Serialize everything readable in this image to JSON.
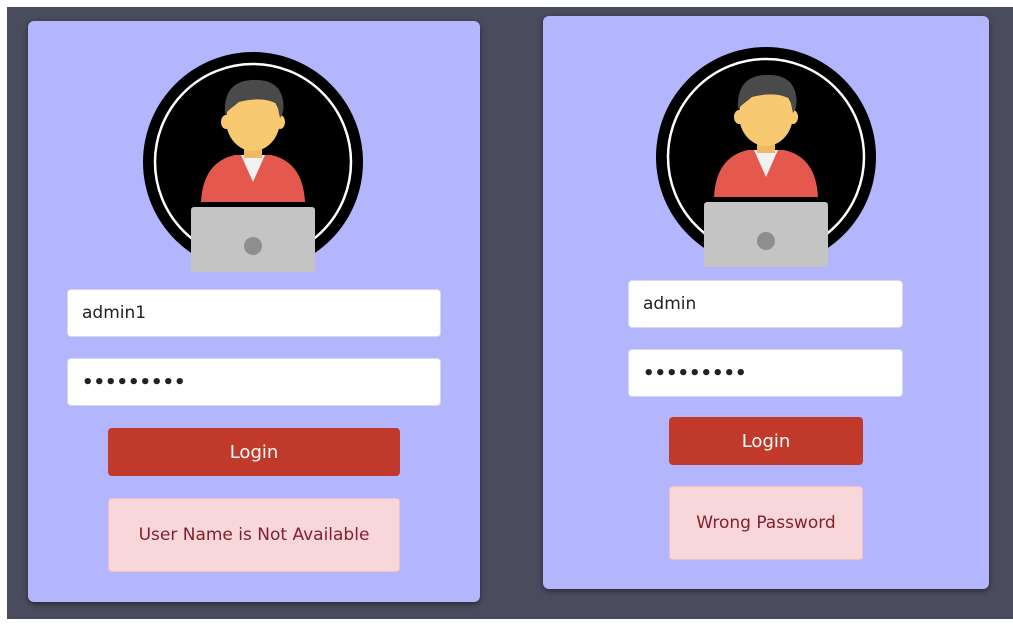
{
  "left_form": {
    "username_value": "admin1",
    "password_value": "•••••••••",
    "login_label": "Login",
    "error_message": "User Name is Not Available"
  },
  "right_form": {
    "username_value": "admin",
    "password_value": "•••••••••",
    "login_label": "Login",
    "error_message": "Wrong Password"
  },
  "icons": {
    "avatar": "user-at-laptop-avatar-icon"
  },
  "colors": {
    "backdrop": "#4a4b5d",
    "card": "#b3b6fd",
    "login_button": "#c0392b",
    "alert_background": "#f8d7da",
    "alert_text": "#842029"
  }
}
